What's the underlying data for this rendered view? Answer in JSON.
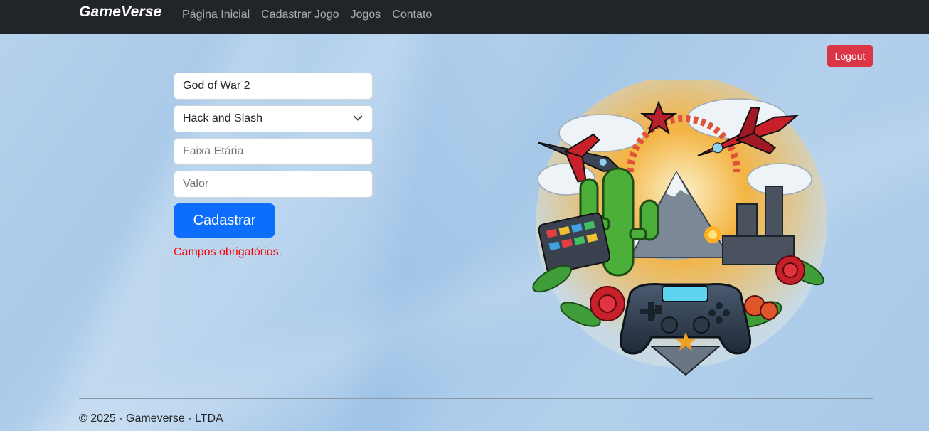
{
  "navbar": {
    "brand": "GameVerse",
    "links": [
      "Página Inicial",
      "Cadastrar Jogo",
      "Jogos",
      "Contato"
    ]
  },
  "logout_label": "Logout",
  "form": {
    "name_value": "God of War 2",
    "genre_selected": "Hack and Slash",
    "age_placeholder": "Faixa Etária",
    "price_placeholder": "Valor",
    "submit_label": "Cadastrar",
    "error_message": "Campos obrigatórios."
  },
  "illustration": {
    "name": "gaming-collage-illustration"
  },
  "footer": {
    "text": "© 2025 - Gameverse - LTDA"
  },
  "colors": {
    "navbar_bg": "#212529",
    "primary": "#0d6efd",
    "danger": "#dc3545",
    "error_text": "#ff0000"
  }
}
